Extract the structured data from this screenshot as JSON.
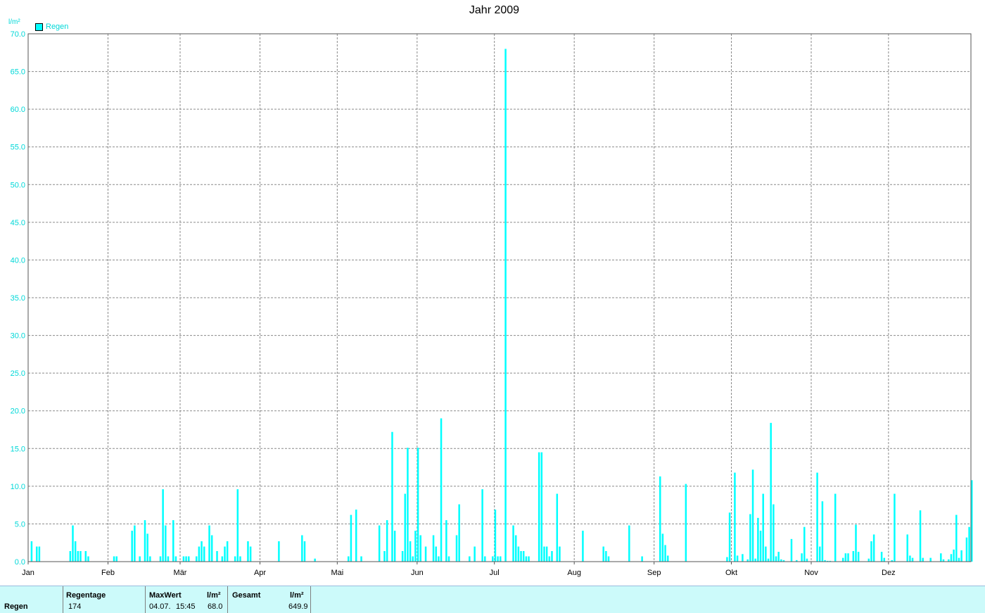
{
  "chart_data": {
    "type": "bar",
    "title": "Jahr 2009",
    "ylabel": "l/m²",
    "ylim": [
      0,
      70
    ],
    "yticks": [
      "0.0",
      "5.0",
      "10.0",
      "15.0",
      "20.0",
      "25.0",
      "30.0",
      "35.0",
      "40.0",
      "45.0",
      "50.0",
      "55.0",
      "60.0",
      "65.0",
      "70.0"
    ],
    "x_range_days": [
      0,
      365
    ],
    "months": [
      {
        "label": "Jan",
        "day": 0
      },
      {
        "label": "Feb",
        "day": 31
      },
      {
        "label": "Mär",
        "day": 59
      },
      {
        "label": "Apr",
        "day": 90
      },
      {
        "label": "Mai",
        "day": 120
      },
      {
        "label": "Jun",
        "day": 151
      },
      {
        "label": "Jul",
        "day": 181
      },
      {
        "label": "Aug",
        "day": 212
      },
      {
        "label": "Sep",
        "day": 243
      },
      {
        "label": "Okt",
        "day": 273
      },
      {
        "label": "Nov",
        "day": 304
      },
      {
        "label": "Dez",
        "day": 334
      }
    ],
    "grid": true,
    "legend_position": "top-left",
    "series": [
      {
        "name": "Regen",
        "color": "#00ffff",
        "points": [
          [
            1,
            2.7
          ],
          [
            3,
            2.0
          ],
          [
            4,
            2.0
          ],
          [
            16,
            1.4
          ],
          [
            17,
            4.8
          ],
          [
            18,
            2.7
          ],
          [
            19,
            1.4
          ],
          [
            20,
            1.4
          ],
          [
            22,
            1.4
          ],
          [
            23,
            0.7
          ],
          [
            33,
            0.7
          ],
          [
            34,
            0.7
          ],
          [
            40,
            4.1
          ],
          [
            41,
            4.8
          ],
          [
            43,
            0.7
          ],
          [
            45,
            5.5
          ],
          [
            46,
            3.7
          ],
          [
            47,
            0.7
          ],
          [
            51,
            0.7
          ],
          [
            52,
            9.6
          ],
          [
            53,
            4.8
          ],
          [
            54,
            0.7
          ],
          [
            56,
            5.5
          ],
          [
            57,
            0.7
          ],
          [
            60,
            0.7
          ],
          [
            61,
            0.7
          ],
          [
            62,
            0.7
          ],
          [
            65,
            0.7
          ],
          [
            66,
            2.0
          ],
          [
            67,
            2.7
          ],
          [
            68,
            2.0
          ],
          [
            70,
            4.8
          ],
          [
            71,
            3.5
          ],
          [
            73,
            1.4
          ],
          [
            75,
            0.7
          ],
          [
            76,
            2.0
          ],
          [
            77,
            2.7
          ],
          [
            80,
            0.7
          ],
          [
            81,
            9.6
          ],
          [
            82,
            0.7
          ],
          [
            85,
            2.7
          ],
          [
            86,
            2.0
          ],
          [
            97,
            2.7
          ],
          [
            106,
            3.5
          ],
          [
            107,
            2.7
          ],
          [
            111,
            0.4
          ],
          [
            124,
            0.7
          ],
          [
            125,
            6.2
          ],
          [
            127,
            6.9
          ],
          [
            129,
            0.7
          ],
          [
            136,
            4.8
          ],
          [
            138,
            1.4
          ],
          [
            139,
            5.5
          ],
          [
            141,
            17.2
          ],
          [
            142,
            4.1
          ],
          [
            145,
            1.4
          ],
          [
            146,
            9.0
          ],
          [
            147,
            15.1
          ],
          [
            148,
            2.7
          ],
          [
            149,
            0.7
          ],
          [
            150,
            4.1
          ],
          [
            151,
            15.1
          ],
          [
            152,
            3.5
          ],
          [
            154,
            2.0
          ],
          [
            157,
            3.5
          ],
          [
            158,
            2.0
          ],
          [
            159,
            0.7
          ],
          [
            160,
            19.0
          ],
          [
            162,
            5.5
          ],
          [
            163,
            0.7
          ],
          [
            166,
            3.5
          ],
          [
            167,
            7.6
          ],
          [
            171,
            0.7
          ],
          [
            173,
            2.0
          ],
          [
            176,
            9.6
          ],
          [
            177,
            0.7
          ],
          [
            180,
            0.7
          ],
          [
            181,
            6.9
          ],
          [
            182,
            0.7
          ],
          [
            183,
            0.7
          ],
          [
            185,
            68.0
          ],
          [
            188,
            4.8
          ],
          [
            189,
            3.5
          ],
          [
            190,
            2.0
          ],
          [
            191,
            1.4
          ],
          [
            192,
            1.4
          ],
          [
            193,
            0.7
          ],
          [
            194,
            0.7
          ],
          [
            198,
            14.5
          ],
          [
            199,
            14.5
          ],
          [
            200,
            2.0
          ],
          [
            201,
            2.0
          ],
          [
            202,
            0.7
          ],
          [
            203,
            1.4
          ],
          [
            205,
            9.0
          ],
          [
            206,
            2.0
          ],
          [
            215,
            4.1
          ],
          [
            223,
            2.0
          ],
          [
            224,
            1.4
          ],
          [
            225,
            0.7
          ],
          [
            233,
            4.8
          ],
          [
            238,
            0.7
          ],
          [
            245,
            11.3
          ],
          [
            246,
            3.7
          ],
          [
            247,
            2.2
          ],
          [
            248,
            0.8
          ],
          [
            255,
            10.3
          ],
          [
            271,
            0.6
          ],
          [
            272,
            6.5
          ],
          [
            274,
            11.8
          ],
          [
            275,
            0.8
          ],
          [
            277,
            1.0
          ],
          [
            279,
            0.3
          ],
          [
            280,
            6.3
          ],
          [
            281,
            12.2
          ],
          [
            282,
            0.4
          ],
          [
            283,
            5.8
          ],
          [
            284,
            4.1
          ],
          [
            285,
            9.0
          ],
          [
            286,
            2.0
          ],
          [
            287,
            0.4
          ],
          [
            288,
            18.4
          ],
          [
            289,
            7.6
          ],
          [
            290,
            0.7
          ],
          [
            291,
            1.3
          ],
          [
            292,
            0.3
          ],
          [
            293,
            0.2
          ],
          [
            296,
            3.0
          ],
          [
            298,
            0.2
          ],
          [
            300,
            1.1
          ],
          [
            301,
            4.6
          ],
          [
            302,
            0.4
          ],
          [
            306,
            11.8
          ],
          [
            307,
            2.0
          ],
          [
            308,
            8.0
          ],
          [
            309,
            0.2
          ],
          [
            310,
            0.1
          ],
          [
            311,
            0.1
          ],
          [
            313,
            9.0
          ],
          [
            316,
            0.5
          ],
          [
            317,
            1.1
          ],
          [
            318,
            1.1
          ],
          [
            320,
            1.4
          ],
          [
            321,
            4.9
          ],
          [
            322,
            1.3
          ],
          [
            326,
            0.4
          ],
          [
            327,
            2.7
          ],
          [
            328,
            3.6
          ],
          [
            331,
            1.3
          ],
          [
            332,
            0.5
          ],
          [
            335,
            0.2
          ],
          [
            336,
            9.0
          ],
          [
            341,
            3.6
          ],
          [
            342,
            0.8
          ],
          [
            343,
            0.5
          ],
          [
            346,
            6.8
          ],
          [
            347,
            0.5
          ],
          [
            350,
            0.5
          ],
          [
            354,
            1.1
          ],
          [
            355,
            0.3
          ],
          [
            357,
            0.3
          ],
          [
            358,
            1.0
          ],
          [
            359,
            1.6
          ],
          [
            360,
            6.2
          ],
          [
            361,
            0.5
          ],
          [
            362,
            1.5
          ],
          [
            364,
            3.2
          ],
          [
            365,
            4.6
          ],
          [
            366,
            10.8
          ]
        ]
      }
    ]
  },
  "legend": {
    "label": "Regen",
    "unit": "l/m²"
  },
  "stats": {
    "row_label": "Regen",
    "regentage_header": "Regentage",
    "regentage_value": "174",
    "maxwert_header": "MaxWert",
    "maxwert_unit_header": "l/m²",
    "maxwert_date": "04.07.",
    "maxwert_time": "15:45",
    "maxwert_value": "68.0",
    "gesamt_header": "Gesamt",
    "gesamt_unit_header": "l/m²",
    "gesamt_value": "649.9"
  }
}
